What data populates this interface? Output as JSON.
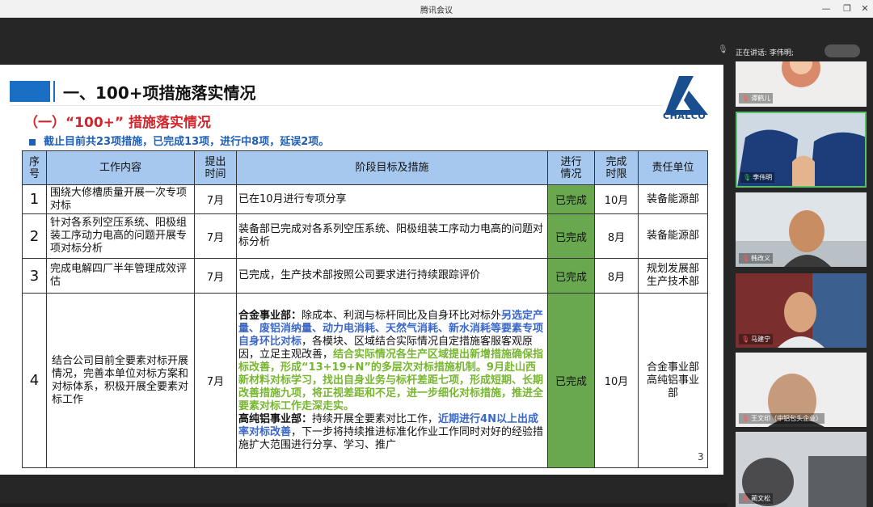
{
  "window": {
    "title": "腾讯会议",
    "minimize": "—",
    "maximize": "❐",
    "close": "✕"
  },
  "slide": {
    "main_title": "一、100+项措施落实情况",
    "sub_title": "（一）“100+” 措施落实情况",
    "summary": "截止目前共23项措施，已完成13项，进行中8项，延误2项。",
    "logo_text": "CHALCO",
    "page_number": "3",
    "table": {
      "headers": [
        "序号",
        "工作内容",
        "提出时间",
        "阶段目标及措施",
        "进行情况",
        "完成时限",
        "责任单位"
      ],
      "rows": [
        {
          "no": "1",
          "work": "围绕大修槽质量开展一次专项对标",
          "time": "7月",
          "measure": "已在10月进行专项分享",
          "status": "已完成",
          "deadline": "10月",
          "unit": "装备能源部"
        },
        {
          "no": "2",
          "work": "针对各系列空压系统、阳极组装工序动力电高的问题开展专项对标分析",
          "time": "7月",
          "measure": "装备部已完成对各系列空压系统、阳极组装工序动力电高的问题对标分析",
          "status": "已完成",
          "deadline": "8月",
          "unit": "装备能源部"
        },
        {
          "no": "3",
          "work": "完成电解四厂半年管理成效评估",
          "time": "7月",
          "measure": "已完成，生产技术部按照公司要求进行持续跟踪评价",
          "status": "已完成",
          "deadline": "8月",
          "unit_line1": "规划发展部",
          "unit_line2": "生产技术部"
        },
        {
          "no": "4",
          "work": "结合公司目前全要素对标开展情况，完善本单位对标方案和对标体系，积极开展全要素对标工作",
          "time": "7月",
          "measure_parts": {
            "p1_label": "合金事业部：",
            "p1_text": "除成本、利润与标杆同比及自身环比对标外",
            "p2_blue": "另选定产量、废铝消纳量、动力电消耗、天然气消耗、新水消耗等要素专项自身环比对标",
            "p3_text": "，各模块、区域结合实际情况自定措施客服客观原因，立足主观改善，",
            "p4_green": "结合实际情况各生产区域提出新增措施确保指标改善，形成“13+19+N”的多层次对标措施机制。9月赴山西新材料对标学习，找出自身业务与标杆差距七项，形成短期、长期改善措施九项，将正视差距和不足，进一步细化对标措施，推进全要素对标工作走深走实。",
            "p5_label": "高纯铝事业部：",
            "p5_text": "持续开展全要素对比工作，",
            "p6_blue": "近期进行4N以上出成率对标改善",
            "p7_text": "，下一步将持续推进标准化作业工作同时对好的经验措施扩大范围进行分享、学习、推广"
          },
          "status": "已完成",
          "deadline": "10月",
          "unit": "合金事业部高纯铝事业部"
        }
      ]
    }
  },
  "participants": {
    "speaking_label": "正在讲话: 李伟明;",
    "tiles": [
      {
        "name": "谭鹤儿",
        "mic": "muted"
      },
      {
        "name": "李伟明",
        "mic": "active"
      },
      {
        "name": "韩改义",
        "mic": "muted"
      },
      {
        "name": "马建宁",
        "mic": "muted"
      },
      {
        "name": "王文印（中铝包头企业）",
        "mic": "muted"
      },
      {
        "name": "蔺文松",
        "mic": "muted"
      }
    ]
  },
  "icons": {
    "mic_muted": "mic-muted-icon",
    "mic_active": "mic-active-icon"
  },
  "colors": {
    "header_blue": "#a6c8ee",
    "status_green": "#6aa84f",
    "title_red": "#d0262c",
    "summary_blue": "#1f5eb5",
    "highlight_blue": "#3b68c8",
    "highlight_green": "#77b62f",
    "active_speaker_border": "#58c26b"
  }
}
